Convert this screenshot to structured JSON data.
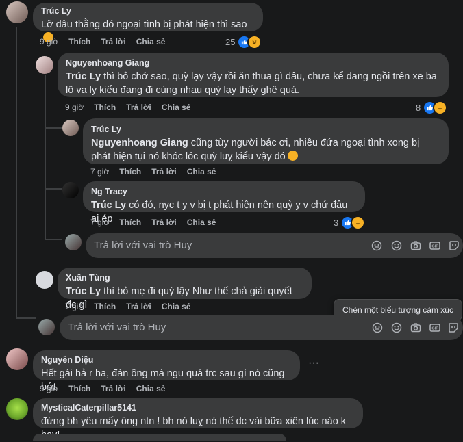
{
  "comments": [
    {
      "name": "Trúc Ly",
      "mention": "",
      "text": "Lỡ đâu thằng đó ngoại tình bị phát hiện thì sao",
      "time": "9 giờ",
      "like": "Thích",
      "reply": "Trả lời",
      "share": "Chia sẻ",
      "reactions": "25"
    },
    {
      "name": "Nguyenhoang Giang",
      "mention": "Trúc Ly",
      "text": " thì bỏ chớ sao, quỳ lạy vậy rồi ăn thua gì đâu, chưa kể đang ngồi trên xe ba lô va ly kiểu đang đi cùng nhau quỳ lạy thấy ghê quá.",
      "time": "9 giờ",
      "like": "Thích",
      "reply": "Trả lời",
      "share": "Chia sẻ",
      "reactions": "8"
    },
    {
      "name": "Trúc Ly",
      "mention": "Nguyenhoang Giang",
      "text": " cũng tùy người bác ơi, nhiều đứa ngoại tình xong bị phát hiện tụi nó khóc lóc quỳ luỵ kiểu vậy đó",
      "time": "7 giờ",
      "like": "Thích",
      "reply": "Trả lời",
      "share": "Chia sẻ"
    },
    {
      "name": "Ng Tracy",
      "mention": "Trúc Ly",
      "text": " có đó, nyc t y v bị t phát hiện nên quỳ y v chứ đâu ai ép",
      "time": "7 giờ",
      "like": "Thích",
      "reply": "Trả lời",
      "share": "Chia sẻ",
      "reactions": "3"
    },
    {
      "name": "Xuân Tùng",
      "mention": "Trúc Ly",
      "text": " thì bỏ mẹ đi quỳ lậy Như thế chả giải quyết đc gì",
      "time": "7 giờ",
      "like": "Thích",
      "reply": "Trả lời",
      "share": "Chia sẻ"
    },
    {
      "name": "Nguyên Diệu",
      "mention": "",
      "text": "Hết gái hả r ha, đàn ông mà ngu quá trc sau gì nó cũng bớt",
      "time": "9 giờ",
      "like": "Thích",
      "reply": "Trả lời",
      "share": "Chia sẻ"
    },
    {
      "name": "MysticalCaterpillar5141",
      "mention": "",
      "text": "đừng bh yêu mấy ông ntn ! bh nó luỵ nó thế dc vài bữa xiên lúc nào k hay!"
    }
  ],
  "reply_placeholder": "Trả lời với vai trò Huy",
  "tooltip": "Chèn một biểu tượng cảm xúc",
  "more": "···",
  "icons": [
    "like-icon",
    "haha-icon",
    "sticker-icon",
    "emoji-icon",
    "camera-icon",
    "gif-icon",
    "avatar-sticker-icon"
  ]
}
